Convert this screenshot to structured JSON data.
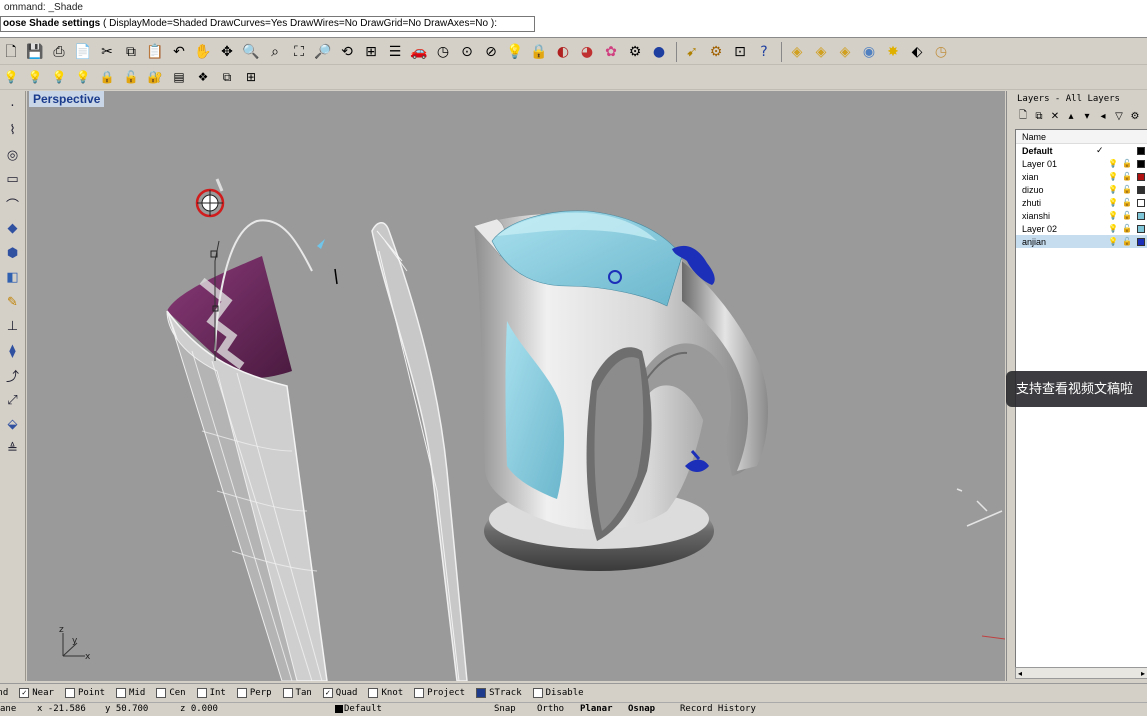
{
  "command": {
    "line1": "ommand: _Shade",
    "prompt": "oose Shade settings",
    "options": "( DisplayMode=Shaded  DrawCurves=Yes  DrawWires=No  DrawGrid=No  DrawAxes=No ):"
  },
  "toolbar_main": [
    "new-file-icon",
    "save-icon",
    "print-icon",
    "import-icon",
    "cut-icon",
    "copy-icon",
    "paste-icon",
    "undo-icon",
    "pan-hand-icon",
    "move-view-icon",
    "zoom-icon",
    "zoom-window-icon",
    "zoom-extents-icon",
    "zoom-selected-icon",
    "rotate-view-icon",
    "four-viewports-icon",
    "properties-icon",
    "car-render-icon",
    "clock-icon",
    "show-icon",
    "hide-icon",
    "light-bulb-icon",
    "lock-icon",
    "shaded-icon",
    "render-icon",
    "color-wheel-icon",
    "settings-gear-icon",
    "sphere-render-icon",
    "dimension-icon",
    "gear-icon",
    "grid-icon",
    "help-icon",
    "tag-icon-1",
    "tag-icon-2",
    "tag-icon-3",
    "sphere-small-icon",
    "star-icon",
    "label-icon",
    "clock-small-icon"
  ],
  "toolbar_layer": [
    "bulb-on-icon",
    "bulb-off-icon",
    "bulb-dim-icon",
    "bulb-group-icon",
    "lock-closed-icon",
    "lock-open-icon",
    "lock-layer-icon",
    "layer-objects-icon",
    "layer-group-icon",
    "layer-match-icon",
    "layer-grid-icon"
  ],
  "left_tools": [
    "point-icon",
    "curve-icon",
    "circle-icon",
    "rectangle-icon",
    "arc-icon",
    "surface-icon",
    "solid-icon",
    "mesh-icon",
    "edit-icon",
    "transform-icon",
    "boolean-icon",
    "analyze-icon",
    "fillet-icon",
    "dimension-icon",
    "align-icon"
  ],
  "viewport": {
    "title": "Perspective",
    "axis_labels": {
      "z": "z",
      "y": "y",
      "x": "x"
    }
  },
  "layers": {
    "title": "Layers - All Layers",
    "header": "Name",
    "rows": [
      {
        "name": "Default",
        "bold": true,
        "current": "✓",
        "color": "#000000",
        "selected": false,
        "visibility": "",
        "lock": ""
      },
      {
        "name": "Layer 01",
        "bold": false,
        "current": "",
        "color": "#000000",
        "selected": false,
        "visibility": "bulb-on-icon",
        "lock": "lock-open-icon"
      },
      {
        "name": "xian",
        "bold": false,
        "current": "",
        "color": "#b01010",
        "selected": false,
        "visibility": "bulb-on-icon",
        "lock": "lock-open-icon"
      },
      {
        "name": "dizuo",
        "bold": false,
        "current": "",
        "color": "#303030",
        "selected": false,
        "visibility": "bulb-on-icon",
        "lock": "lock-open-icon"
      },
      {
        "name": "zhuti",
        "bold": false,
        "current": "",
        "color": "#ffffff",
        "selected": false,
        "visibility": "bulb-on-icon",
        "lock": "lock-open-icon"
      },
      {
        "name": "xianshi",
        "bold": false,
        "current": "",
        "color": "#7ec6d8",
        "selected": false,
        "visibility": "bulb-on-icon",
        "lock": "lock-open-icon"
      },
      {
        "name": "Layer 02",
        "bold": false,
        "current": "",
        "color": "#7ec6d8",
        "selected": false,
        "visibility": "bulb-on-icon",
        "lock": "lock-open-icon"
      },
      {
        "name": "anjian",
        "bold": false,
        "current": "",
        "color": "#1c2fb8",
        "selected": true,
        "visibility": "bulb-on-icon",
        "lock": "lock-open-icon"
      }
    ]
  },
  "overlay_text": "支持查看视频文稿啦",
  "osnap": [
    {
      "label": "End",
      "checked": false,
      "partial": true
    },
    {
      "label": "Near",
      "checked": true
    },
    {
      "label": "Point",
      "checked": false
    },
    {
      "label": "Mid",
      "checked": false
    },
    {
      "label": "Cen",
      "checked": false
    },
    {
      "label": "Int",
      "checked": false
    },
    {
      "label": "Perp",
      "checked": false
    },
    {
      "label": "Tan",
      "checked": false
    },
    {
      "label": "Quad",
      "checked": true
    },
    {
      "label": "Knot",
      "checked": false
    },
    {
      "label": "Project",
      "checked": false
    },
    {
      "label": "STrack",
      "checked": false,
      "filled": true
    },
    {
      "label": "Disable",
      "checked": false
    }
  ],
  "status": {
    "plane": "ane",
    "x": "x -21.586",
    "y": "y 50.700",
    "z": "z 0.000",
    "layer": "Default",
    "snap": "Snap",
    "ortho": "Ortho",
    "planar": "Planar",
    "osnap": "Osnap",
    "history": "Record History"
  },
  "colors": {
    "viewport_bg": "#9a9a9a",
    "kettle_blue": "#7ec6d8",
    "button_blue": "#1c2fb8",
    "purple_surface": "#6b2a5c"
  }
}
